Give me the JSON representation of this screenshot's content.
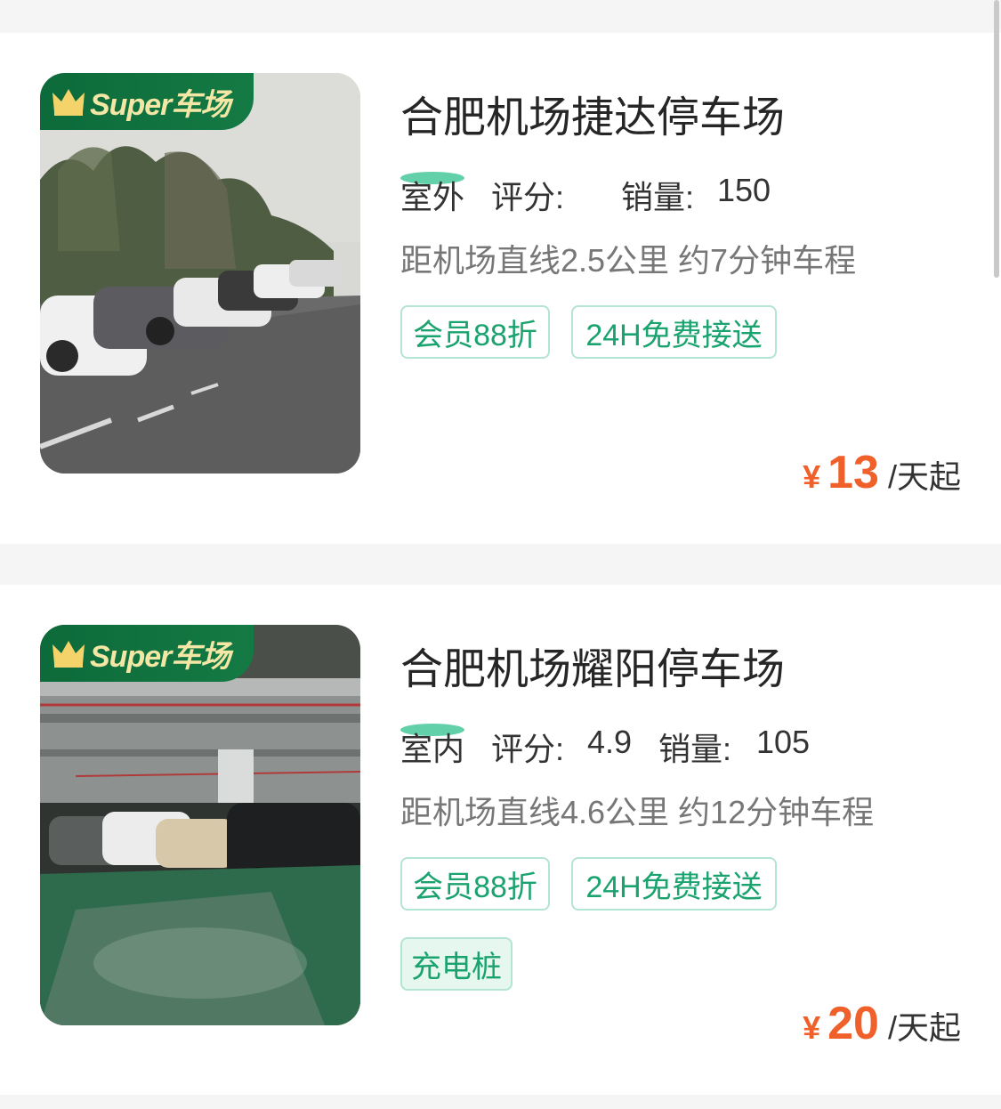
{
  "badge": {
    "text": "Super车场"
  },
  "listings": [
    {
      "title": "合肥机场捷达停车场",
      "environment": "室外",
      "rating_label": "评分:",
      "rating": "",
      "sales_label": "销量:",
      "sales": "150",
      "distance": "距机场直线2.5公里 约7分钟车程",
      "tags": [
        "会员88折",
        "24H免费接送"
      ],
      "price": {
        "currency": "¥",
        "amount": "13",
        "unit": "/天起"
      }
    },
    {
      "title": "合肥机场耀阳停车场",
      "environment": "室内",
      "rating_label": "评分:",
      "rating": "4.9",
      "sales_label": "销量:",
      "sales": "105",
      "distance": "距机场直线4.6公里 约12分钟车程",
      "tags": [
        "会员88折",
        "24H免费接送",
        "充电桩"
      ],
      "price": {
        "currency": "¥",
        "amount": "20",
        "unit": "/天起"
      }
    }
  ],
  "colors": {
    "accent_green": "#1aa36f",
    "price_orange": "#f0602a",
    "badge_green": "#0d6a3a"
  }
}
